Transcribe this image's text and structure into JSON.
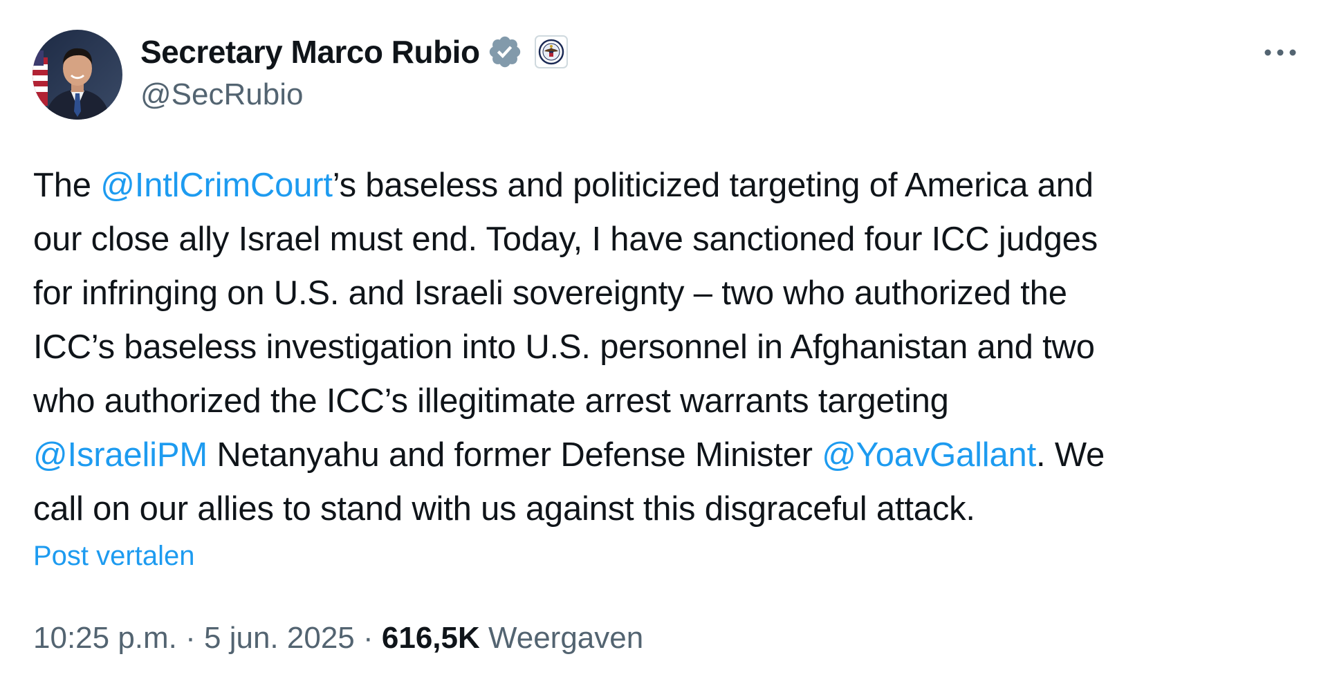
{
  "author": {
    "display_name": "Secretary Marco Rubio",
    "handle": "@SecRubio"
  },
  "body": {
    "line1": {
      "pre": "The ",
      "mention": "@IntlCrimCourt",
      "post": "’s baseless and politicized targeting of America and"
    },
    "line2": "our close ally Israel must end. Today, I have sanctioned four ICC judges",
    "line3": "for infringing on U.S. and Israeli sovereignty – two who authorized the",
    "line4": "ICC’s baseless investigation into U.S. personnel in Afghanistan and two",
    "line5": "who authorized the ICC’s illegitimate arrest warrants targeting",
    "line6": {
      "mention1": "@IsraeliPM",
      "mid": " Netanyahu and former Defense Minister ",
      "mention2": "@YoavGallant",
      "post": ". We"
    },
    "line7": "call on our allies to stand with us against this disgraceful attack."
  },
  "translate_label": "Post vertalen",
  "meta": {
    "time": "10:25 p.m.",
    "separator": " · ",
    "date": "5 jun. 2025",
    "views_count": "616,5K",
    "views_label": " Weergaven"
  },
  "icons": {
    "verified": "verified-badge-icon",
    "affiliate": "us-state-department-seal-icon",
    "more": "more-options-icon"
  },
  "colors": {
    "link": "#1d9bf0",
    "text": "#0f1419",
    "secondary": "#536471",
    "verified_badge": "#829aab"
  }
}
